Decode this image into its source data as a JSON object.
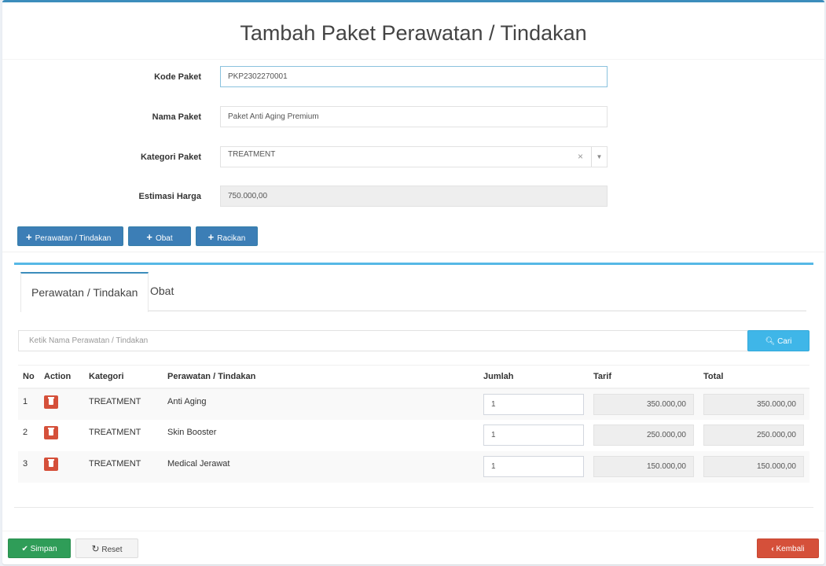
{
  "page_title": "Tambah Paket Perawatan / Tindakan",
  "form": {
    "kode_label": "Kode Paket",
    "kode_value": "PKP2302270001",
    "nama_label": "Nama Paket",
    "nama_value": "Paket Anti Aging Premium",
    "kategori_label": "Kategori Paket",
    "kategori_value": "TREATMENT",
    "kategori_clear": "×",
    "estimasi_label": "Estimasi Harga",
    "estimasi_value": "750.000,00"
  },
  "add_buttons": {
    "perawatan": "Perawatan / Tindakan",
    "obat": "Obat",
    "racikan": "Racikan"
  },
  "tabs": [
    {
      "label": "Perawatan / Tindakan",
      "active": true
    },
    {
      "label": "Obat",
      "active": false
    }
  ],
  "search": {
    "placeholder": "Ketik Nama Perawatan / Tindakan",
    "button_label": "Cari"
  },
  "table": {
    "headers": [
      "No",
      "Action",
      "Kategori",
      "Perawatan / Tindakan",
      "Jumlah",
      "Tarif",
      "Total"
    ],
    "rows": [
      {
        "no": "1",
        "kategori": "TREATMENT",
        "nama": "Anti Aging",
        "jumlah": "1",
        "tarif": "350.000,00",
        "total": "350.000,00"
      },
      {
        "no": "2",
        "kategori": "TREATMENT",
        "nama": "Skin Booster",
        "jumlah": "1",
        "tarif": "250.000,00",
        "total": "250.000,00"
      },
      {
        "no": "3",
        "kategori": "TREATMENT",
        "nama": "Medical Jerawat",
        "jumlah": "1",
        "tarif": "150.000,00",
        "total": "150.000,00"
      }
    ]
  },
  "footer": {
    "simpan": "Simpan",
    "reset": "Reset",
    "kembali": "Kembali"
  },
  "colors": {
    "primary": "#3c7eb6",
    "info": "#3fb6e8",
    "success": "#2f9d58",
    "danger": "#d5503a"
  }
}
